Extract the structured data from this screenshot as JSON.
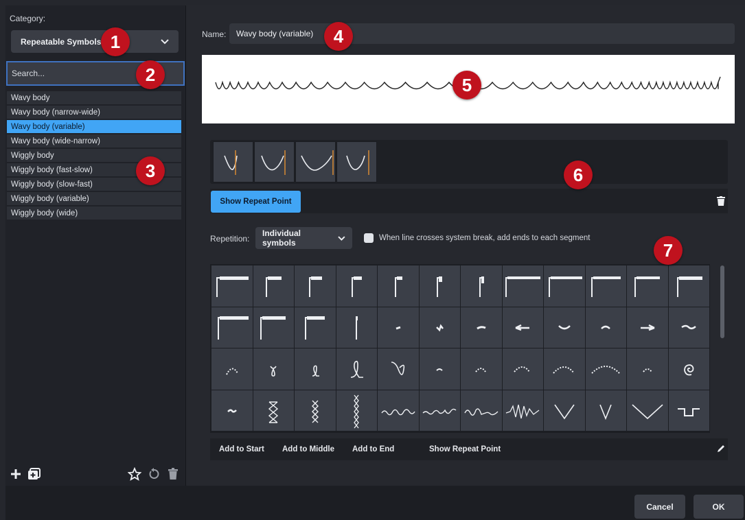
{
  "sidebar": {
    "category_label": "Category:",
    "category_value": "Repeatable Symbols",
    "search_placeholder": "Search...",
    "items": [
      {
        "label": "Wavy body"
      },
      {
        "label": "Wavy body (narrow-wide)"
      },
      {
        "label": "Wavy body (variable)",
        "selected": true
      },
      {
        "label": "Wavy body (wide-narrow)"
      },
      {
        "label": "Wiggly body"
      },
      {
        "label": "Wiggly body (fast-slow)"
      },
      {
        "label": "Wiggly body (slow-fast)"
      },
      {
        "label": "Wiggly body (variable)"
      },
      {
        "label": "Wiggly body (wide)"
      }
    ],
    "tools": [
      "add-icon",
      "duplicate-icon",
      "star-icon",
      "revert-icon",
      "delete-icon"
    ]
  },
  "editor": {
    "name_label": "Name:",
    "name_value": "Wavy body (variable)",
    "show_repeat_point_label": "Show Repeat Point",
    "repetition_label": "Repetition:",
    "repetition_value": "Individual symbols",
    "checkbox_label": "When line crosses system break, add ends to each segment",
    "actions": {
      "add_to_start": "Add to Start",
      "add_to_middle": "Add to Middle",
      "add_to_end": "Add to End",
      "show_repeat_point": "Show Repeat Point"
    }
  },
  "footer": {
    "cancel_label": "Cancel",
    "ok_label": "OK"
  },
  "markers": [
    "1",
    "2",
    "3",
    "4",
    "5",
    "6",
    "7"
  ],
  "colors": {
    "accent": "#41a5f5",
    "marker": "#c0121e",
    "background": "#26282e"
  }
}
